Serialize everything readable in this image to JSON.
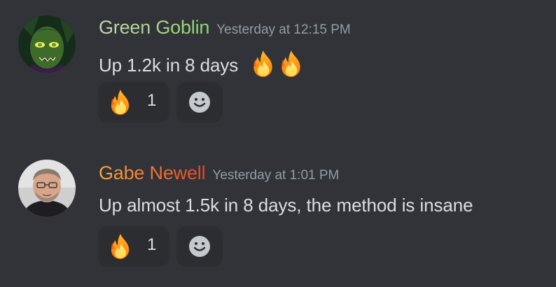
{
  "messages": [
    {
      "username": "Green Goblin",
      "timestamp": "Yesterday at 12:15 PM",
      "text": "Up 1.2k in 8 days",
      "emojis": [
        "fire",
        "fire"
      ],
      "reaction": {
        "emoji": "fire",
        "count": "1"
      },
      "name_colors": [
        "#c9d4b0",
        "#8dd66a"
      ]
    },
    {
      "username": "Gabe Newell",
      "timestamp": "Yesterday at 1:01 PM",
      "text": "Up almost 1.5k in 8 days, the method is insane",
      "reaction": {
        "emoji": "fire",
        "count": "1"
      },
      "name_colors": [
        "#f6a83a",
        "#e8442c"
      ]
    }
  ],
  "theme": {
    "background": "#313338",
    "reaction_background": "#2b2d31",
    "timestamp_color": "#949ba4",
    "text_color": "#dbdee1"
  },
  "icons": {
    "add_reaction": "smiley-face-icon",
    "reaction_emoji": "fire-emoji"
  }
}
